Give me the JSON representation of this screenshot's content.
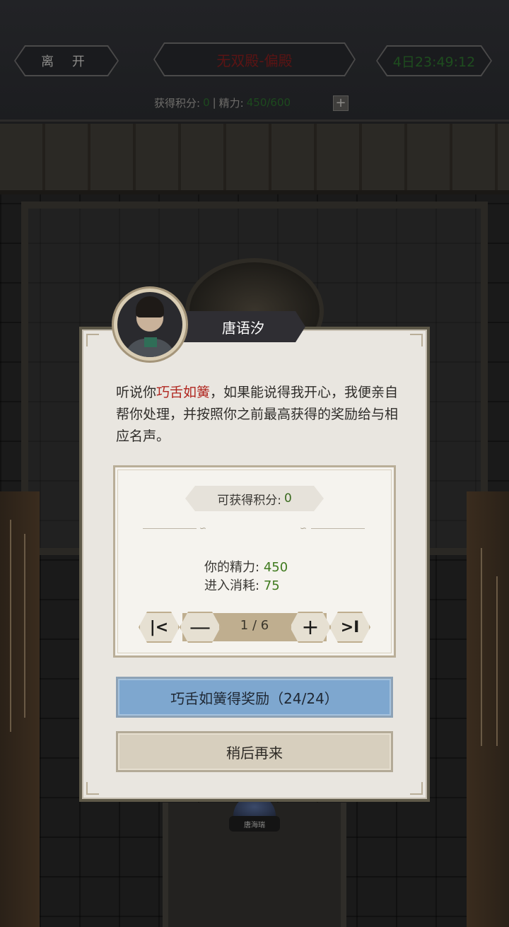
{
  "header": {
    "leave_label": "离 开",
    "stage_title": "无双殿-偏殿",
    "countdown": "4日23:49:12",
    "points_label": "获得积分:",
    "points_value": "0",
    "separator": "|",
    "energy_label": "精力:",
    "energy_value": "450/600",
    "plus_glyph": "+"
  },
  "scene": {
    "npc_name_small": "唐海瑞"
  },
  "dialog": {
    "npc_name": "唐语汐",
    "speech_before": "听说你",
    "speech_highlight": "巧舌如簧",
    "speech_after": "，如果能说得我开心，我便亲自帮你处理，并按照你之前最高获得的奖励给与相应名声。",
    "points_label": "可获得积分:",
    "points_value": "0",
    "energy_label": "你的精力:",
    "energy_value": "450",
    "cost_label": "进入消耗:",
    "cost_value": "75",
    "pager": {
      "first_glyph": "K",
      "minus_glyph": "—",
      "current": "1 / 6",
      "plus_glyph": "+",
      "last_glyph": ">I"
    },
    "primary_button": "巧舌如簧得奖励（24/24）",
    "secondary_button": "稍后再来"
  },
  "colors": {
    "dialog_bg": "#e9e6e0",
    "highlight_red": "#b0261f",
    "value_green": "#3f7a1e",
    "primary_blue": "#7ea7cf",
    "secondary_beige": "#d7cfbe"
  }
}
